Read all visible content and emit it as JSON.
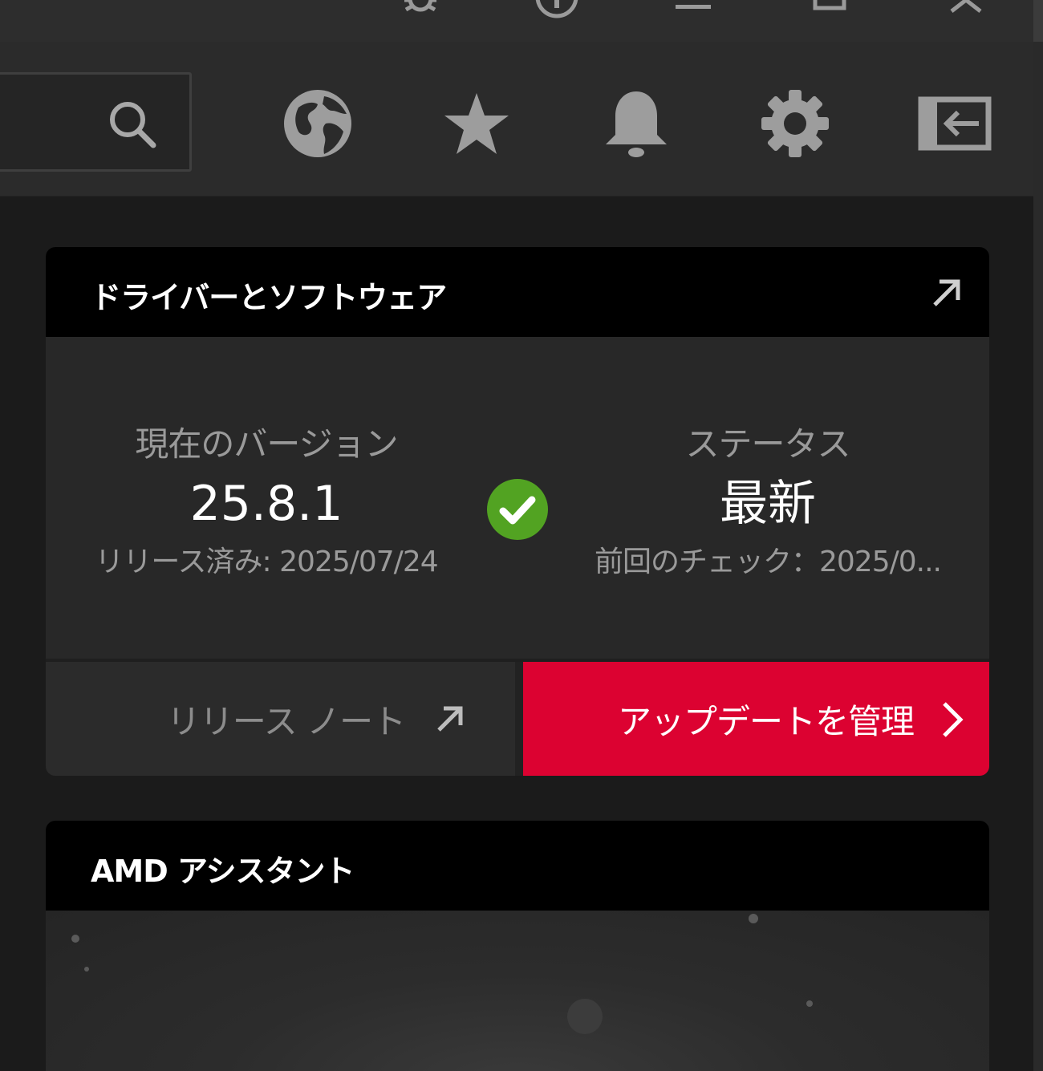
{
  "titlebar": {
    "icons": [
      "bug-icon",
      "info-icon",
      "minimize-icon",
      "maximize-icon",
      "close-icon"
    ]
  },
  "header": {
    "search": {
      "placeholder": "",
      "icon": "search-icon"
    },
    "icons": [
      "globe-icon",
      "star-icon",
      "bell-icon",
      "gear-icon",
      "collapse-panel-icon"
    ]
  },
  "drivers_card": {
    "title": "ドライバーとソフトウェア",
    "current_version_label": "現在のバージョン",
    "current_version_value": "25.8.1",
    "released_text": "リリース済み: 2025/07/24",
    "status_label": "ステータス",
    "status_value": "最新",
    "last_checked_text": "前回のチェック：2025/0...",
    "release_notes_label": "リリース ノート",
    "manage_updates_label": "アップデートを管理",
    "status_color": "#52a322",
    "accent_color": "#dc0231"
  },
  "assistant_card": {
    "title": "AMD アシスタント"
  }
}
